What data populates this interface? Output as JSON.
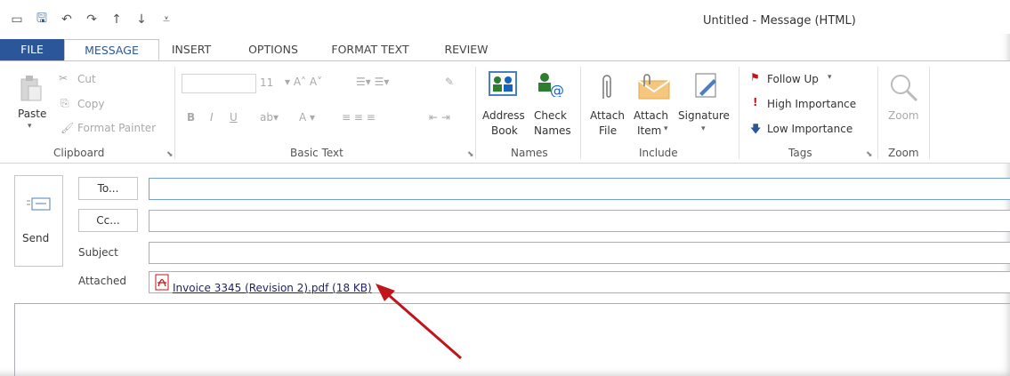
{
  "window": {
    "title": "Untitled - Message (HTML)"
  },
  "tabs": [
    {
      "label": "FILE"
    },
    {
      "label": "MESSAGE"
    },
    {
      "label": "INSERT"
    },
    {
      "label": "OPTIONS"
    },
    {
      "label": "FORMAT TEXT"
    },
    {
      "label": "REVIEW"
    }
  ],
  "ribbon": {
    "clipboard": {
      "paste": "Paste",
      "cut": "Cut",
      "copy": "Copy",
      "format_painter": "Format Painter",
      "label": "Clipboard"
    },
    "basic_text": {
      "font_size": "11",
      "label": "Basic Text"
    },
    "names": {
      "address_book_1": "Address",
      "address_book_2": "Book",
      "check_names_1": "Check",
      "check_names_2": "Names",
      "label": "Names"
    },
    "include": {
      "attach_file_1": "Attach",
      "attach_file_2": "File",
      "attach_item_1": "Attach",
      "attach_item_2": "Item",
      "signature": "Signature",
      "label": "Include"
    },
    "tags": {
      "follow_up": "Follow Up",
      "high_importance": "High Importance",
      "low_importance": "Low Importance",
      "label": "Tags"
    },
    "zoom": {
      "zoom": "Zoom",
      "label": "Zoom"
    }
  },
  "compose": {
    "send": "Send",
    "to": "To...",
    "cc": "Cc...",
    "subject_label": "Subject",
    "attached_label": "Attached",
    "attachment": "Invoice 3345 (Revision 2).pdf (18 KB)"
  },
  "colors": {
    "accent": "#2b579a",
    "arrow": "#c0151b",
    "pdf": "#c8151b"
  }
}
